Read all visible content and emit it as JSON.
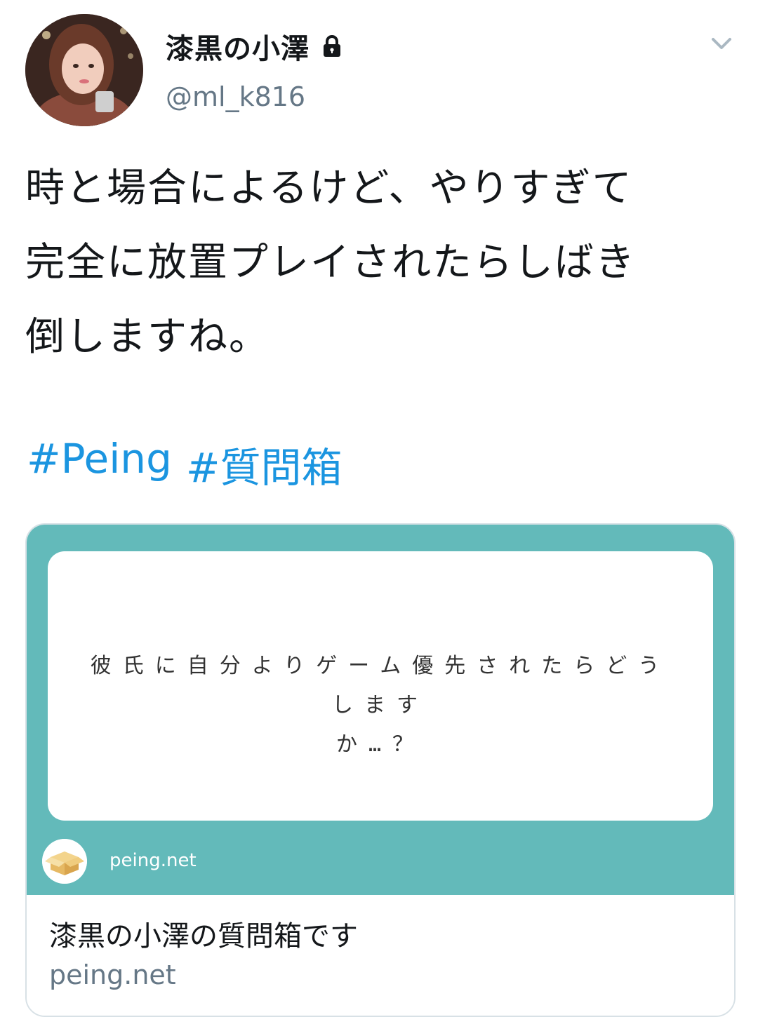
{
  "user": {
    "display_name": "漆黒の小澤",
    "handle": "@ml_k816",
    "protected_icon": "lock-icon"
  },
  "tweet": {
    "lines": [
      "時と場合によるけど、やりすぎて",
      "完全に放置プレイされたらしばき",
      "倒しますね。"
    ],
    "hashtags": [
      "#Peing",
      "#質問箱"
    ]
  },
  "card": {
    "question_lines": [
      "彼氏に自分よりゲーム優先されたらどうします",
      "か…？"
    ],
    "image_domain": "peing.net",
    "title": "漆黒の小澤の質問箱です",
    "domain": "peing.net"
  },
  "colors": {
    "link": "#1b95e0",
    "card_teal": "#63baba",
    "secondary_text": "#657786"
  }
}
